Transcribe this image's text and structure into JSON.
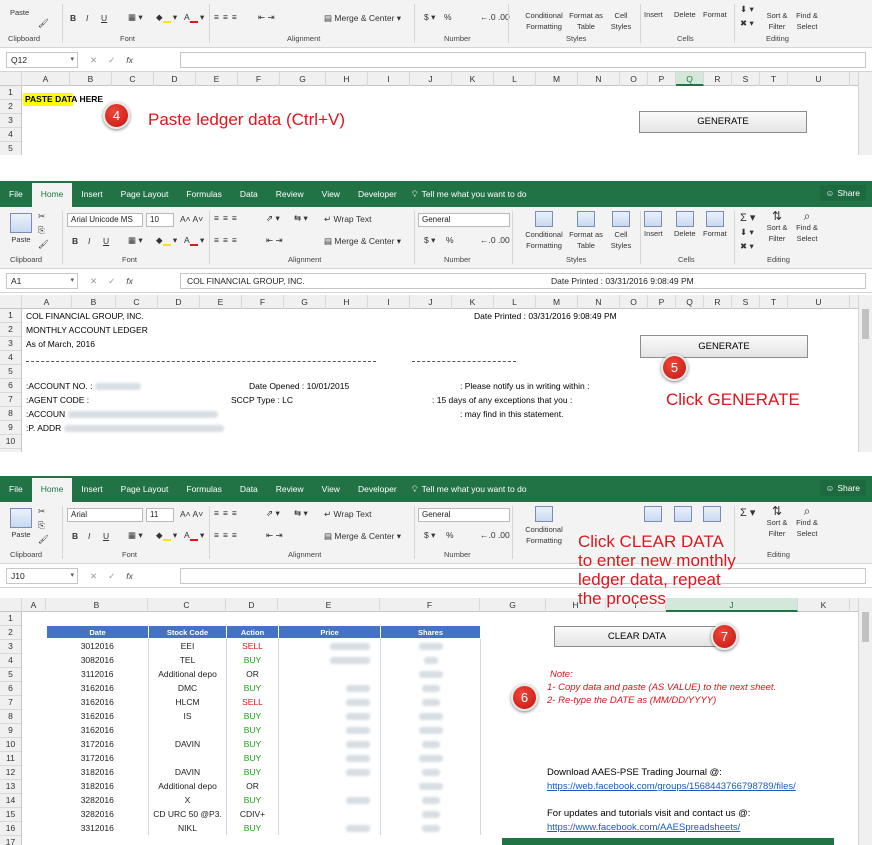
{
  "ribbon": {
    "tabs": [
      "File",
      "Home",
      "Insert",
      "Page Layout",
      "Formulas",
      "Data",
      "Review",
      "View",
      "Developer"
    ],
    "tell_me": "Tell me what you want to do",
    "share": "Share",
    "paste": "Paste",
    "font_name_1": "Arial Unicode MS",
    "font_name_2": "Arial",
    "font_size_1": "10",
    "font_size_2": "11",
    "bold": "B",
    "italic": "I",
    "underline": "U",
    "wrap_text": "Wrap Text",
    "merge_center": "Merge & Center",
    "number_format": "General",
    "currency": "$",
    "percent": "%",
    "conditional_formatting": "Conditional Formatting",
    "format_as_table": "Format as Table",
    "cell_styles": "Cell Styles",
    "insert": "Insert",
    "delete": "Delete",
    "format": "Format",
    "sort_filter": "Sort & Filter",
    "find_select": "Find & Select",
    "group_labels": [
      "Clipboard",
      "Font",
      "Alignment",
      "Number",
      "Styles",
      "Cells",
      "Editing"
    ]
  },
  "panel1": {
    "name_box": "Q12",
    "formula": "",
    "a1_text": "PASTE DATA HERE",
    "generate_button": "GENERATE",
    "callout": "4",
    "annotation": "Paste ledger data (Ctrl+V)",
    "columns": [
      "A",
      "B",
      "C",
      "D",
      "E",
      "F",
      "G",
      "H",
      "I",
      "J",
      "K",
      "L",
      "M",
      "N",
      "O",
      "P",
      "Q",
      "R",
      "S",
      "T",
      "U"
    ],
    "rows": [
      "1",
      "2",
      "3",
      "4",
      "5"
    ]
  },
  "panel2": {
    "name_box": "A1",
    "formula": "COL FINANCIAL GROUP, INC.",
    "formula_date": "Date Printed : 03/31/2016 9:08:49 PM",
    "generate_button": "GENERATE",
    "callout": "5",
    "annotation": "Click GENERATE",
    "columns": [
      "A",
      "B",
      "C",
      "D",
      "E",
      "F",
      "G",
      "H",
      "I",
      "J",
      "K",
      "L",
      "M",
      "N",
      "O",
      "P",
      "Q",
      "R",
      "S",
      "T",
      "U"
    ],
    "rows": [
      "1",
      "2",
      "3",
      "4",
      "5",
      "6",
      "7",
      "8",
      "9",
      "10"
    ],
    "lines": {
      "company": "COL FINANCIAL GROUP, INC.",
      "date_printed": "Date Printed : 03/31/2016 9:08:49 PM",
      "title": "MONTHLY ACCOUNT LEDGER",
      "as_of": "As of March, 2016",
      "account_no": ":ACCOUNT NO.   :",
      "date_opened": "Date Opened    : 10/01/2015",
      "notify": ": Please notify us in writing within :",
      "agent_code": ":AGENT CODE    :",
      "sccp_type": "SCCP Type      : LC",
      "days": ": 15 days of any exceptions that you :",
      "account_name": ":ACCOUN",
      "may_find": ": may find in this statement.",
      "address": ":P. ADDR"
    }
  },
  "panel3": {
    "name_box": "J10",
    "formula": "",
    "columns": [
      "A",
      "B",
      "C",
      "D",
      "E",
      "F",
      "G",
      "H",
      "I",
      "J",
      "K"
    ],
    "rows": [
      "1",
      "2",
      "3",
      "4",
      "5",
      "6",
      "7",
      "8",
      "9",
      "10",
      "11",
      "12",
      "13",
      "14",
      "15",
      "16",
      "17"
    ],
    "table_headers": [
      "Date",
      "Stock Code",
      "Action",
      "Price",
      "Shares"
    ],
    "table_rows": [
      {
        "date": "3012016",
        "code": "EEI",
        "action": "SELL"
      },
      {
        "date": "3082016",
        "code": "TEL",
        "action": "BUY"
      },
      {
        "date": "3112016",
        "code": "Additional depo",
        "action": "OR"
      },
      {
        "date": "3162016",
        "code": "DMC",
        "action": "BUY"
      },
      {
        "date": "3162016",
        "code": "HLCM",
        "action": "SELL"
      },
      {
        "date": "3162016",
        "code": "IS",
        "action": "BUY"
      },
      {
        "date": "3162016",
        "code": "",
        "action": "BUY"
      },
      {
        "date": "3172016",
        "code": "DAVIN",
        "action": "BUY"
      },
      {
        "date": "3172016",
        "code": "",
        "action": "BUY"
      },
      {
        "date": "3182016",
        "code": "DAVIN",
        "action": "BUY"
      },
      {
        "date": "3182016",
        "code": "Additional depo",
        "action": "OR"
      },
      {
        "date": "3282016",
        "code": "X",
        "action": "BUY"
      },
      {
        "date": "3282016",
        "code": "CD URC 50 @P3.",
        "action": "CDIV+"
      },
      {
        "date": "3312016",
        "code": "NIKL",
        "action": "BUY"
      }
    ],
    "clear_button": "CLEAR DATA",
    "callout_6": "6",
    "callout_7": "7",
    "annotation_lines": [
      "Click CLEAR DATA",
      "to enter new monthly",
      "ledger data, repeat",
      "the process"
    ],
    "note_title": "Note:",
    "note_1": "1- Copy data and paste (AS VALUE) to the next sheet.",
    "note_2": "2- Re-type the DATE as (MM/DD/YYYY)",
    "download_text": "Download AAES-PSE Trading Journal @:",
    "download_link": "https://web.facebook.com/groups/1568443766798789/files/",
    "updates_text": "For updates and tutorials visit and contact us @:",
    "updates_link": "https://www.facebook.com/AAESpreadsheets/"
  },
  "colors": {
    "excel_green": "#217346",
    "annotation_red": "#e0141b",
    "table_header": "#4472c4",
    "buy_green": "#1aa31a"
  }
}
